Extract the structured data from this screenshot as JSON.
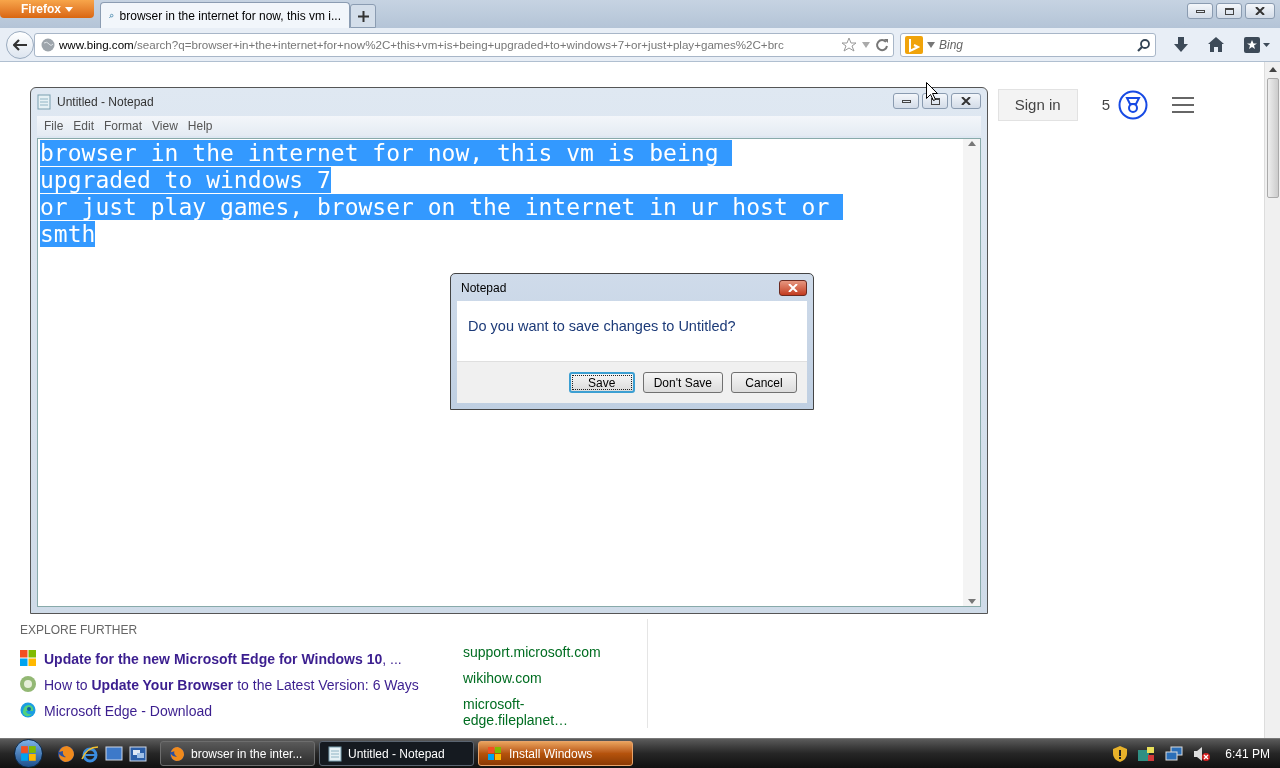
{
  "browser": {
    "menu_button": "Firefox",
    "tabs": [
      {
        "label": "browser in the internet for now, this vm i...",
        "selected": true
      }
    ],
    "url_host": "www.bing.com",
    "url_path": "/search?q=browser+in+the+internet+for+now%2C+this+vm+is+being+upgraded+to+windows+7+or+just+play+games%2C+brc",
    "search_placeholder": "Bing"
  },
  "page": {
    "sign_in": "Sign in",
    "rewards_count": "5",
    "explore_further": {
      "heading": "EXPLORE FURTHER",
      "items": [
        {
          "kind": "windows",
          "title": "**Update for the new Microsoft Edge for Windows 10**, ...",
          "source": "support.microsoft.com"
        },
        {
          "kind": "wikihow",
          "title": "How to **Update Your Browser** to the Latest Version: 6 Ways",
          "source": "wikihow.com"
        },
        {
          "kind": "edge",
          "title": "Microsoft Edge - Download",
          "source": "microsoft-edge.fileplanet…"
        }
      ]
    }
  },
  "notepad": {
    "title": "Untitled - Notepad",
    "menu": [
      "File",
      "Edit",
      "Format",
      "View",
      "Help"
    ],
    "lines": [
      "browser in the internet for now, this vm is being ",
      "upgraded to windows 7",
      "or just play games, browser on the internet in ur host or ",
      "smth"
    ],
    "selected": true
  },
  "dialog": {
    "title": "Notepad",
    "message": "Do you want to save changes to Untitled?",
    "buttons": [
      {
        "label": "Save",
        "default": true
      },
      {
        "label": "Don't Save",
        "default": false
      },
      {
        "label": "Cancel",
        "default": false
      }
    ]
  },
  "taskbar": {
    "tasks": [
      {
        "kind": "firefox",
        "label": "browser in the inter...",
        "selected": false,
        "flashing": false
      },
      {
        "kind": "notepad",
        "label": "Untitled - Notepad",
        "selected": true,
        "flashing": false
      },
      {
        "kind": "installer",
        "label": "Install Windows",
        "selected": false,
        "flashing": true
      }
    ],
    "clock": "6:41 PM"
  }
}
